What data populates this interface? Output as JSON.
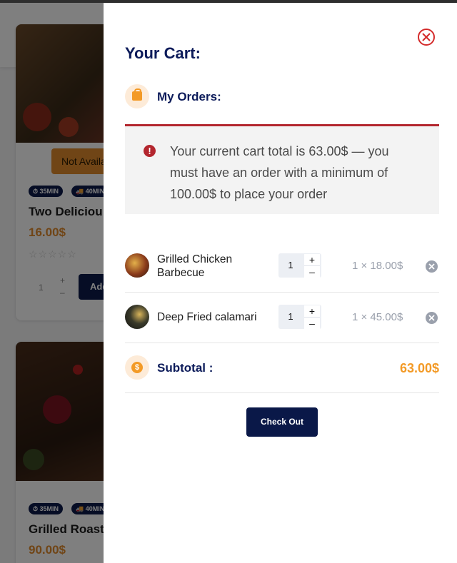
{
  "background": {
    "card1": {
      "status_button": "Not Availa",
      "tag_time": "35MIN",
      "tag_delivery": "40MIN",
      "title": "Two Deliciou",
      "price": "16.00$",
      "qty_plus": "+",
      "qty_minus": "–",
      "qty_value": "1",
      "add_button": "Add"
    },
    "card2": {
      "tag_time": "35MIN",
      "tag_delivery": "40MIN",
      "title": "Grilled Roast",
      "price": "90.00$"
    }
  },
  "cart": {
    "title": "Your Cart:",
    "orders_label": "My Orders:",
    "alert_message": "Your current cart total is 63.00$ — you must have an order with a minimum of 100.00$ to place your order",
    "alert_icon": "!",
    "items": [
      {
        "name": "Grilled Chicken Barbecue",
        "qty": "1",
        "plus": "+",
        "minus": "–",
        "price": "1 × 18.00$"
      },
      {
        "name": "Deep Fried calamari",
        "qty": "1",
        "plus": "+",
        "minus": "–",
        "price": "1 × 45.00$"
      }
    ],
    "subtotal_label": "Subtotal :",
    "subtotal_value": "63.00$",
    "subtotal_icon": "$",
    "checkout_label": "Check Out"
  },
  "colors": {
    "navy": "#0c1b5a",
    "accent_orange": "#f39a26",
    "alert_red": "#b3262e",
    "close_red": "#d42b2b"
  },
  "icons": [
    "close-icon",
    "shopping-bag-icon",
    "alert-icon",
    "remove-icon",
    "dollar-coin-icon",
    "clock-icon",
    "truck-icon"
  ]
}
